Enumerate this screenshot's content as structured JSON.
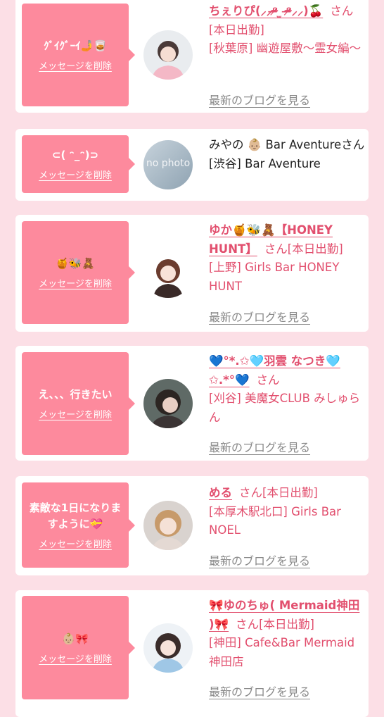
{
  "delete_label": "メッセージを削除",
  "blog_label": "最新のブログを見る",
  "honorific": "さん",
  "colors": {
    "accent_pink": "#fd8a9d",
    "name_pink": "#e24f6e",
    "background": "#fcdfe6",
    "link_gray": "#8a8a8a"
  },
  "cards": [
    {
      "message": "ｸﾞｲｸﾞｰｲ🤳🥃",
      "name": "ちぇりぴ(⸝⸝ᵒ̴̶̷ ̫ ᵒ̴̶̷⸝⸝)🍒",
      "status": "[本日出勤]",
      "shop": "[秋葉原] 幽遊屋敷〜霊女編〜",
      "blog": true
    },
    {
      "message": "⊂( ᵔ_ᵔ)⊃",
      "name": "みやの 👶🏼 Bar Aventure",
      "status": "",
      "shop": "[渋谷] Bar Aventure",
      "avatar_text": "no photo",
      "blog": false
    },
    {
      "message": "🍯🐝🧸",
      "name": "ゆか🍯🐝🧸【HONEY HUNT】",
      "status": "[本日出勤]",
      "shop": "[上野] Girls Bar HONEY HUNT",
      "blog": true
    },
    {
      "message": "え、、、行きたい",
      "name": "💙°*.✩🩵羽雲 なつき🩵✩.*°💙",
      "status": "",
      "shop": "[刈谷] 美魔女CLUB みしゅらん",
      "blog": true
    },
    {
      "message": "素敵な1日になりますように💝",
      "name": "める",
      "status": "[本日出勤]",
      "shop": "[本厚木駅北口] Girls Bar NOEL",
      "blog": true
    },
    {
      "message": "👶🏼🎀",
      "name": "🎀ゆのちゅ( Mermaid神田 )🎀",
      "status": "[本日出勤]",
      "shop": "[神田] Cafe&Bar Mermaid神田店",
      "blog": true
    }
  ]
}
